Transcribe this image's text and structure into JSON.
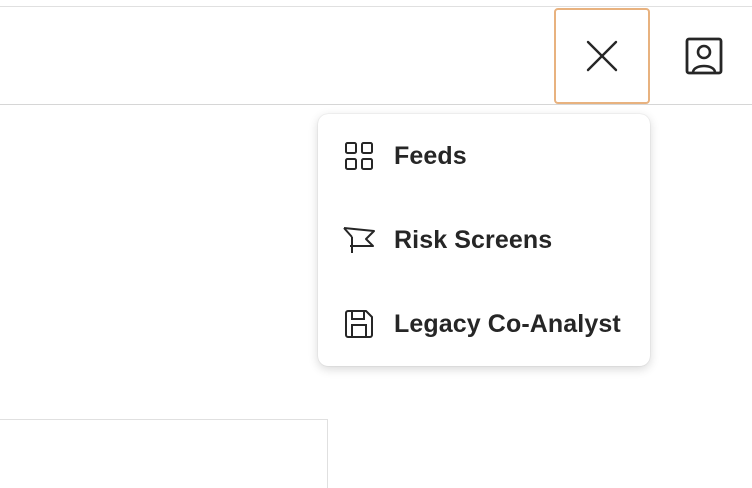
{
  "header": {
    "close_button": {
      "icon": "close-icon",
      "accent_color": "#e8b27f"
    },
    "profile_button": {
      "icon": "user-profile-icon"
    }
  },
  "menu": {
    "items": [
      {
        "label": "Feeds",
        "icon": "grid-icon"
      },
      {
        "label": "Risk Screens",
        "icon": "flag-icon"
      },
      {
        "label": "Legacy Co-Analyst",
        "icon": "save-icon"
      }
    ]
  }
}
